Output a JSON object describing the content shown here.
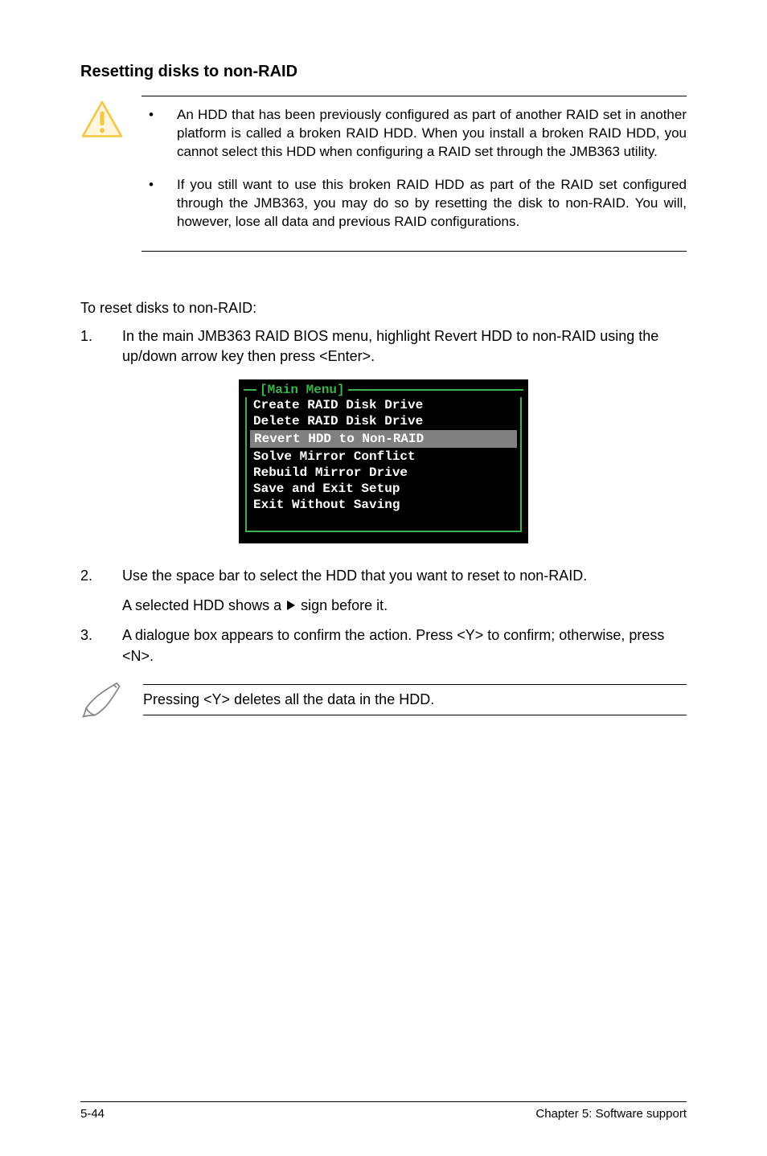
{
  "heading": "Resetting disks to non-RAID",
  "caution": {
    "items": [
      "An HDD that has been previously configured as part of another RAID set in another platform is called a broken RAID HDD. When you install a broken RAID HDD, you cannot select this HDD when configuring a RAID set through the JMB363 utility.",
      "If you still want to use this broken RAID HDD as part of the RAID set configured through the JMB363, you may do so by resetting the disk to non-RAID. You will, however, lose all data and previous RAID configurations."
    ]
  },
  "intro": "To reset disks to non-RAID:",
  "steps": {
    "s1_num": "1.",
    "s1_text": "In the main JMB363 RAID BIOS menu, highlight Revert HDD to non-RAID using the up/down arrow key then press <Enter>.",
    "s2_num": "2.",
    "s2_text": "Use the space bar to select the HDD that you want to reset to non-RAID.",
    "s2_sub_prefix": "A selected HDD shows a ",
    "s2_sub_suffix": " sign before it.",
    "s3_num": "3.",
    "s3_text": "A dialogue box appears to confirm the action. Press <Y> to confirm; otherwise, press <N>."
  },
  "bios": {
    "title": "[Main Menu]",
    "items": [
      "Create RAID Disk Drive",
      "Delete RAID Disk Drive",
      "Revert HDD to Non-RAID",
      "Solve Mirror Conflict",
      "Rebuild Mirror Drive",
      "Save and Exit Setup",
      "Exit Without Saving"
    ],
    "selected_index": 2
  },
  "note": "Pressing <Y> deletes all the data in the HDD.",
  "footer": {
    "left": "5-44",
    "right": "Chapter 5: Software support"
  }
}
